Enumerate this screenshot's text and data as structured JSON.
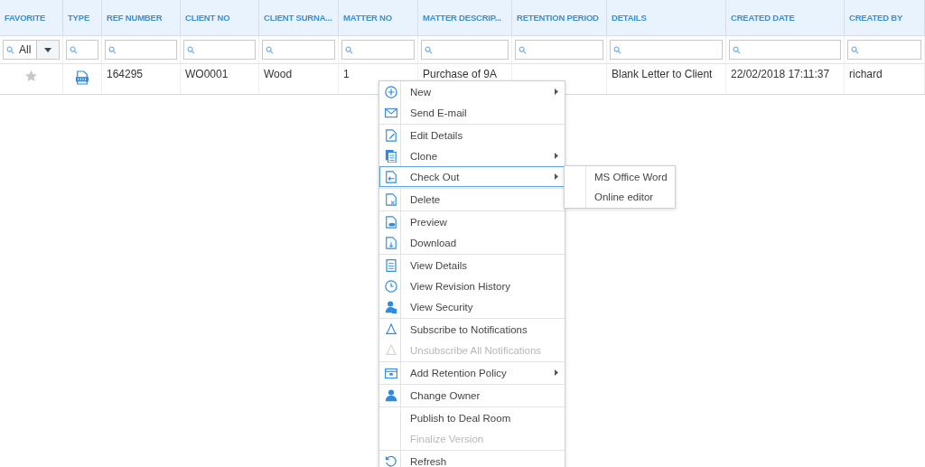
{
  "table": {
    "columns": [
      {
        "label": "FAVORITE",
        "filter": {
          "kind": "select",
          "value": "All"
        }
      },
      {
        "label": "TYPE",
        "filter": {
          "kind": "search"
        }
      },
      {
        "label": "REF NUMBER",
        "filter": {
          "kind": "search"
        }
      },
      {
        "label": "CLIENT NO",
        "filter": {
          "kind": "search"
        }
      },
      {
        "label": "CLIENT SURNA...",
        "filter": {
          "kind": "search"
        }
      },
      {
        "label": "MATTER NO",
        "filter": {
          "kind": "search"
        }
      },
      {
        "label": "MATTER DESCRIP...",
        "filter": {
          "kind": "search"
        }
      },
      {
        "label": "RETENTION PERIOD",
        "filter": {
          "kind": "search"
        }
      },
      {
        "label": "DETAILS",
        "filter": {
          "kind": "search"
        }
      },
      {
        "label": "CREATED DATE",
        "filter": {
          "kind": "search"
        }
      },
      {
        "label": "CREATED BY",
        "filter": {
          "kind": "search"
        }
      }
    ],
    "rows": [
      {
        "favorite": false,
        "ref_number": "164295",
        "client_no": "WO0001",
        "client_surname": "Wood",
        "matter_no": "1",
        "matter_description": "Purchase of 9A",
        "details": "Blank Letter to Client",
        "created_date": "22/02/2018 17:11:37",
        "created_by": "richard"
      }
    ]
  },
  "context_menu": {
    "groups": [
      {
        "items": [
          {
            "label": "New",
            "kind": "plus",
            "disabled": false,
            "submenu": true,
            "selected": false
          },
          {
            "label": "Send E-mail",
            "kind": "mail",
            "disabled": false,
            "submenu": false,
            "selected": false
          }
        ]
      },
      {
        "items": [
          {
            "label": "Edit Details",
            "kind": "edit",
            "disabled": false,
            "submenu": false,
            "selected": false
          },
          {
            "label": "Clone",
            "kind": "clone",
            "disabled": false,
            "submenu": true,
            "selected": false
          },
          {
            "label": "Check Out",
            "kind": "checkout",
            "disabled": false,
            "submenu": true,
            "selected": true
          }
        ]
      },
      {
        "items": [
          {
            "label": "Delete",
            "kind": "delete",
            "disabled": false,
            "submenu": false,
            "selected": false
          }
        ]
      },
      {
        "items": [
          {
            "label": "Preview",
            "kind": "preview",
            "disabled": false,
            "submenu": false,
            "selected": false
          },
          {
            "label": "Download",
            "kind": "download",
            "disabled": false,
            "submenu": false,
            "selected": false
          }
        ]
      },
      {
        "items": [
          {
            "label": "View Details",
            "kind": "details",
            "disabled": false,
            "submenu": false,
            "selected": false
          },
          {
            "label": "View Revision History",
            "kind": "clock",
            "disabled": false,
            "submenu": false,
            "selected": false
          },
          {
            "label": "View Security",
            "kind": "security",
            "disabled": false,
            "submenu": false,
            "selected": false
          }
        ]
      },
      {
        "items": [
          {
            "label": "Subscribe to Notifications",
            "kind": "bell",
            "disabled": false,
            "submenu": false,
            "selected": false
          },
          {
            "label": "Unsubscribe All Notifications",
            "kind": "bell",
            "disabled": true,
            "submenu": false,
            "selected": false
          }
        ]
      },
      {
        "items": [
          {
            "label": "Add Retention Policy",
            "kind": "calendar",
            "disabled": false,
            "submenu": true,
            "selected": false
          }
        ]
      },
      {
        "items": [
          {
            "label": "Change Owner",
            "kind": "owner",
            "disabled": false,
            "submenu": false,
            "selected": false
          }
        ]
      },
      {
        "items": [
          {
            "label": "Publish to Deal Room",
            "kind": "plain",
            "disabled": false,
            "submenu": false,
            "selected": false
          },
          {
            "label": "Finalize Version",
            "kind": "plain",
            "disabled": true,
            "submenu": false,
            "selected": false
          }
        ]
      },
      {
        "items": [
          {
            "label": "Refresh",
            "kind": "refresh",
            "disabled": false,
            "submenu": false,
            "selected": false
          }
        ]
      }
    ]
  },
  "submenu": {
    "items": [
      {
        "label": "MS Office Word"
      },
      {
        "label": "Online editor"
      }
    ]
  }
}
